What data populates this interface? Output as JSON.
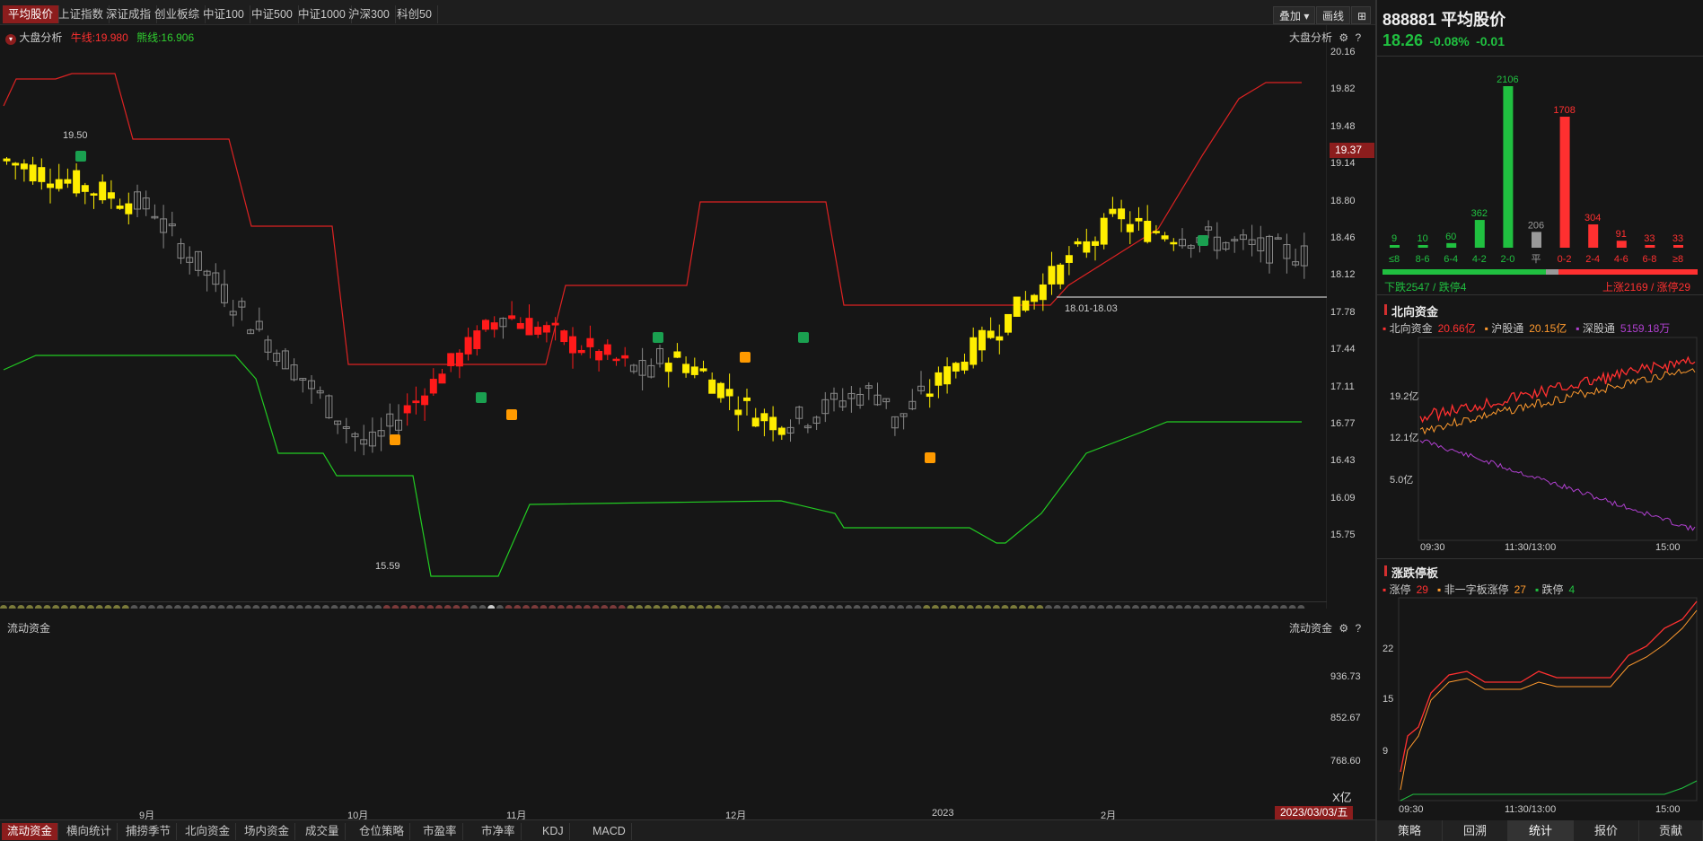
{
  "top_tabs": [
    "平均股价",
    "上证指数",
    "深证成指",
    "创业板综",
    "中证100",
    "中证500",
    "中证1000",
    "沪深300",
    "科创50"
  ],
  "top_right": {
    "overlay": "叠加",
    "draw": "画线"
  },
  "main": {
    "label": "大盘分析",
    "bull_line": "牛线:19.980",
    "bear_line": "熊线:16.906",
    "right_label": "大盘分析",
    "y_ticks": [
      "20.16",
      "19.82",
      "19.48",
      "19.14",
      "18.80",
      "18.46",
      "18.12",
      "17.78",
      "17.44",
      "17.11",
      "16.77",
      "16.43",
      "16.09",
      "15.75"
    ],
    "current_price_tag": "19.37",
    "high_label": "19.50",
    "low_label": "15.59",
    "range_label": "18.01-18.03",
    "x_ticks": [
      "9月",
      "10月",
      "11月",
      "12月",
      "2023",
      "2月"
    ],
    "date_tag": "2023/03/03/五"
  },
  "sub": {
    "label": "流动资金",
    "right_label": "流动资金",
    "y_ticks": [
      "936.73",
      "852.67",
      "768.60"
    ],
    "unit": "X亿"
  },
  "bottom_tabs": [
    "流动资金",
    "横向统计",
    "捕捞季节",
    "北向资金",
    "场内资金",
    "成交量",
    "仓位策略",
    "市盈率",
    "市净率",
    "KDJ",
    "MACD"
  ],
  "quote": {
    "code": "888881",
    "name": "平均股价",
    "price": "18.26",
    "pct": "-0.08%",
    "chg": "-0.01"
  },
  "dist": {
    "labels": [
      "≤8",
      "8-6",
      "6-4",
      "4-2",
      "2-0",
      "平",
      "0-2",
      "2-4",
      "4-6",
      "6-8",
      "≥8"
    ],
    "values": [
      9,
      10,
      60,
      362,
      2106,
      206,
      1708,
      304,
      91,
      33,
      33
    ],
    "value_labels": [
      "9",
      "10",
      "60",
      "362",
      "2106",
      "206",
      "1708",
      "304",
      "91",
      "33",
      "33"
    ],
    "down_text": "下跌2547 / 跌停4",
    "up_text": "上涨2169 / 涨停29"
  },
  "north": {
    "title": "北向资金",
    "legend": [
      {
        "name": "北向资金",
        "value": "20.66亿",
        "color": "#ff3030"
      },
      {
        "name": "沪股通",
        "value": "20.15亿",
        "color": "#ff9a2e"
      },
      {
        "name": "深股通",
        "value": "5159.18万",
        "color": "#b040d0"
      }
    ],
    "y_ticks": [
      "19.2亿",
      "12.1亿",
      "5.0亿"
    ],
    "x_ticks": [
      "09:30",
      "11:30/13:00",
      "15:00"
    ]
  },
  "limit": {
    "title": "涨跌停板",
    "legend": [
      {
        "name": "涨停",
        "value": "29",
        "color": "#ff3030"
      },
      {
        "name": "非一字板涨停",
        "value": "27",
        "color": "#ff9a2e"
      },
      {
        "name": "跌停",
        "value": "4",
        "color": "#20c040"
      }
    ],
    "y_ticks": [
      "22",
      "15",
      "9"
    ],
    "x_ticks": [
      "09:30",
      "11:30/13:00",
      "15:00"
    ]
  },
  "right_bottom_tabs": [
    "策略",
    "回溯",
    "统计",
    "报价",
    "贡献"
  ]
}
